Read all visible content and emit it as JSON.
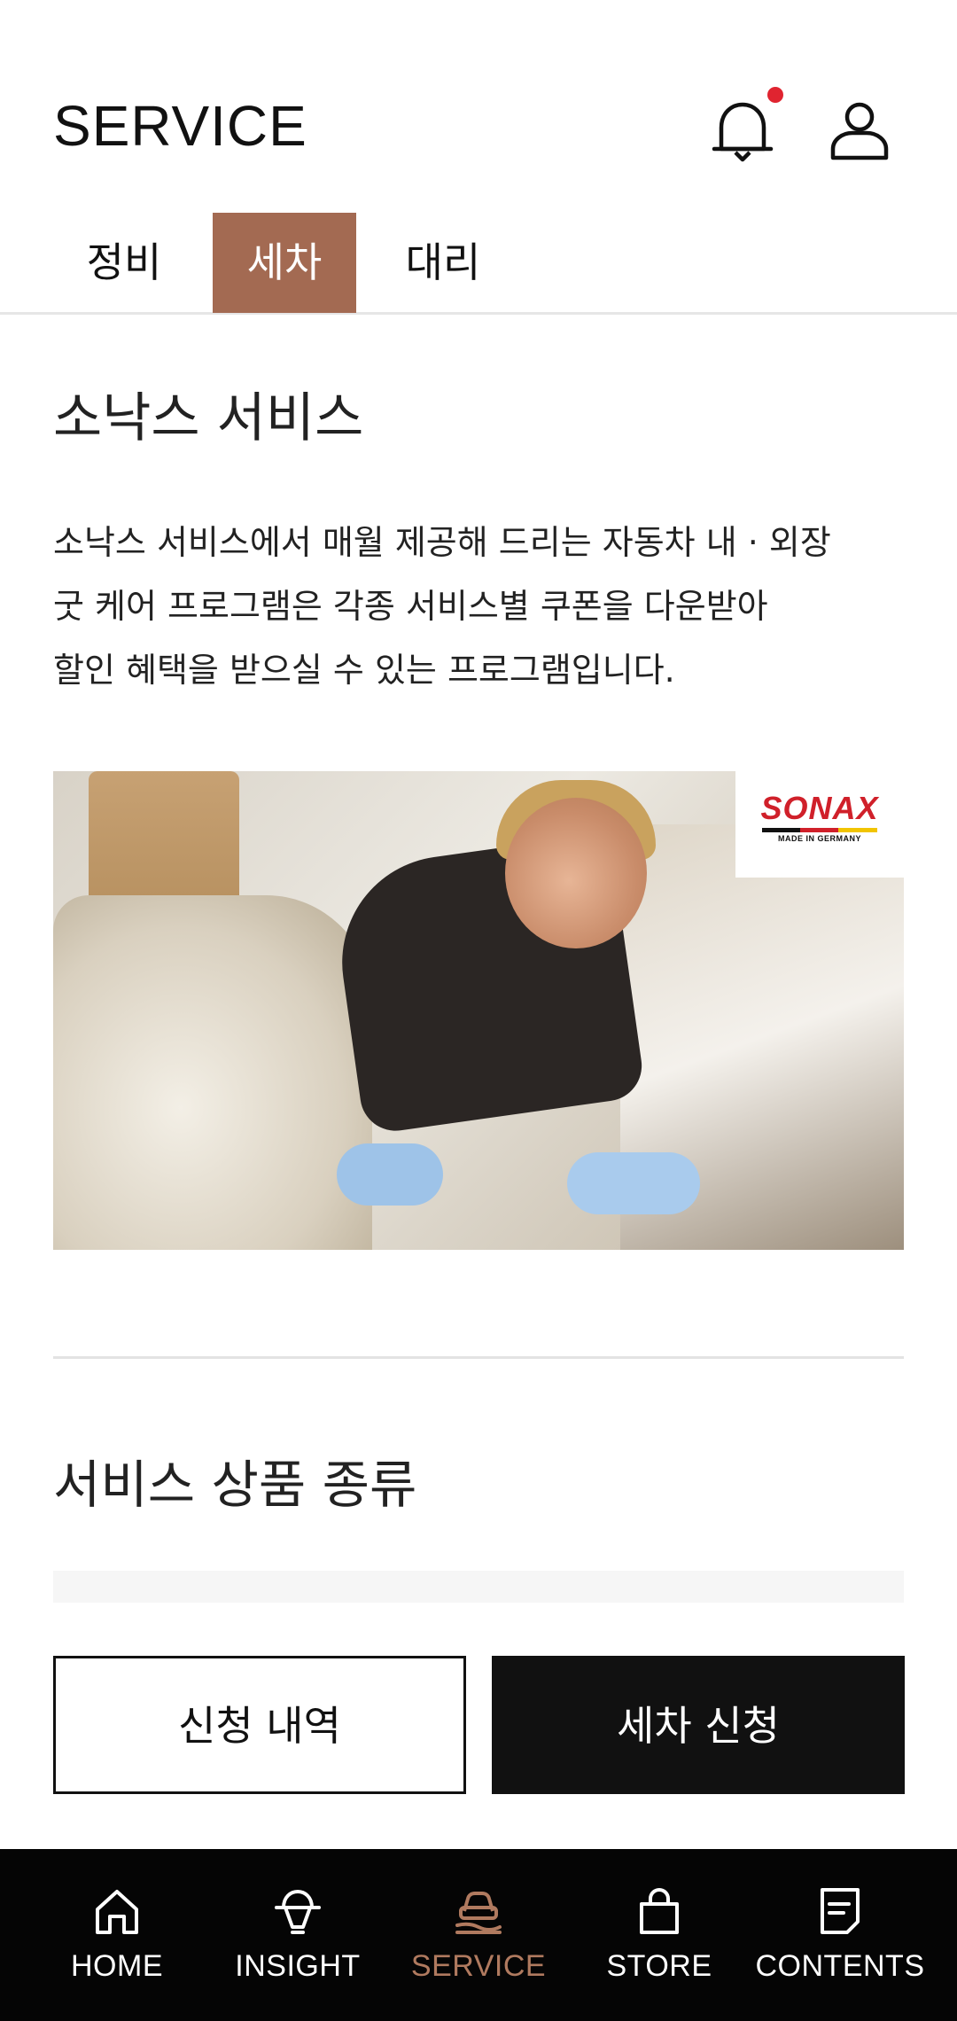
{
  "header": {
    "title": "SERVICE",
    "notification_icon": "bell-icon",
    "notification_badge_color": "#e02430",
    "profile_icon": "user-icon"
  },
  "tabs": [
    {
      "label": "정비",
      "active": false
    },
    {
      "label": "세차",
      "active": true
    },
    {
      "label": "대리",
      "active": false
    }
  ],
  "accent_color": "#a36a52",
  "intro": {
    "title": "소낙스 서비스",
    "description_lines": [
      "소낙스 서비스에서 매월 제공해 드리는 자동차 내 · 외장",
      "굿 케어 프로그램은 각종 서비스별 쿠폰을 다운받아",
      "할인 혜택을 받으실 수 있는 프로그램입니다."
    ]
  },
  "promo_image": {
    "logo_text": "SONAX",
    "logo_subtext": "MADE IN GERMANY"
  },
  "products": {
    "title": "서비스 상품 종류"
  },
  "actions": {
    "history_label": "신청 내역",
    "request_label": "세차 신청"
  },
  "bottom_nav": [
    {
      "label": "HOME",
      "icon": "home-icon",
      "active": false
    },
    {
      "label": "INSIGHT",
      "icon": "insight-icon",
      "active": false
    },
    {
      "label": "SERVICE",
      "icon": "service-icon",
      "active": true
    },
    {
      "label": "STORE",
      "icon": "shopping-bag-icon",
      "active": false
    },
    {
      "label": "CONTENTS",
      "icon": "document-icon",
      "active": false
    }
  ],
  "nav_active_color": "#b07a5f"
}
